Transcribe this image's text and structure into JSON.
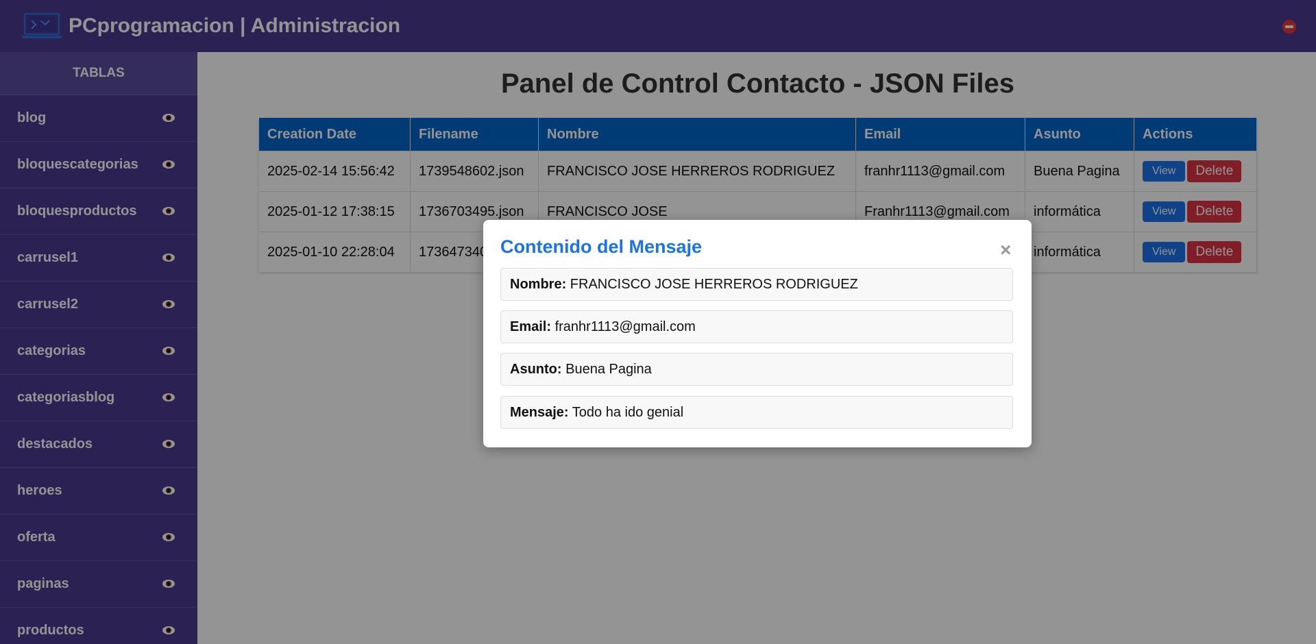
{
  "header": {
    "title": "PCprogramacion | Administracion",
    "logout_icon": "no-entry-icon"
  },
  "sidebar": {
    "heading": "TABLAS",
    "items": [
      {
        "label": "blog"
      },
      {
        "label": "bloquescategorias"
      },
      {
        "label": "bloquesproductos"
      },
      {
        "label": "carrusel1"
      },
      {
        "label": "carrusel2"
      },
      {
        "label": "categorias"
      },
      {
        "label": "categoriasblog"
      },
      {
        "label": "destacados"
      },
      {
        "label": "heroes"
      },
      {
        "label": "oferta"
      },
      {
        "label": "paginas"
      },
      {
        "label": "productos"
      }
    ]
  },
  "main": {
    "title": "Panel de Control Contacto - JSON Files",
    "table": {
      "headers": [
        "Creation Date",
        "Filename",
        "Nombre",
        "Email",
        "Asunto",
        "Actions"
      ],
      "rows": [
        {
          "date": "2025-02-14 15:56:42",
          "file": "1739548602.json",
          "nombre": "FRANCISCO JOSE HERREROS RODRIGUEZ",
          "email": "franhr1113@gmail.com",
          "asunto": "Buena Pagina"
        },
        {
          "date": "2025-01-12 17:38:15",
          "file": "1736703495.json",
          "nombre": "FRANCISCO JOSE",
          "email": "Franhr1113@gmail.com",
          "asunto": "informática"
        },
        {
          "date": "2025-01-10 22:28:04",
          "file": "173647340",
          "nombre": "",
          "email": "",
          "asunto": "informática"
        }
      ],
      "view_label": "View",
      "delete_label": "Delete"
    }
  },
  "modal": {
    "title": "Contenido del Mensaje",
    "close": "×",
    "fields": [
      {
        "label": "Nombre:",
        "value": "FRANCISCO JOSE HERREROS RODRIGUEZ"
      },
      {
        "label": "Email:",
        "value": "franhr1113@gmail.com"
      },
      {
        "label": "Asunto:",
        "value": "Buena Pagina"
      },
      {
        "label": "Mensaje:",
        "value": "Todo ha ido genial"
      }
    ]
  },
  "colors": {
    "header_bg": "#4a3b8f",
    "table_header": "#0066cc",
    "view_button": "#1a73e8",
    "delete_button": "#dc3545",
    "modal_title": "#1a73e8"
  }
}
